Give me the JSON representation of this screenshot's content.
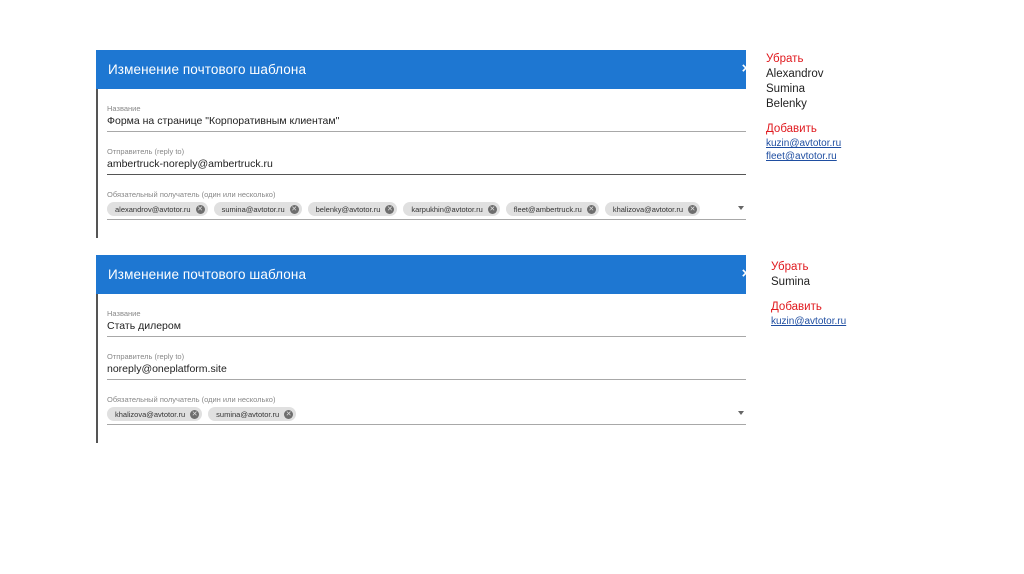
{
  "dialogs": [
    {
      "title": "Изменение почтового шаблона",
      "close_glyph": "×",
      "name_label": "Название",
      "name_value": "Форма на странице \"Корпоративным клиентам\"",
      "sender_label": "Отправитель (reply to)",
      "sender_value": "ambertruck-noreply@ambertruck.ru",
      "recipients_label": "Обязательный получатель (один или несколько)",
      "recipients": [
        "alexandrov@avtotor.ru",
        "sumina@avtotor.ru",
        "belenky@avtotor.ru",
        "karpukhin@avtotor.ru",
        "fleet@ambertruck.ru",
        "khalizova@avtotor.ru"
      ]
    },
    {
      "title": "Изменение почтового шаблона",
      "close_glyph": "×",
      "name_label": "Название",
      "name_value": "Стать дилером",
      "sender_label": "Отправитель (reply to)",
      "sender_value": "noreply@oneplatform.site",
      "recipients_label": "Обязательный получатель (один или несколько)",
      "recipients": [
        "khalizova@avtotor.ru",
        "sumina@avtotor.ru"
      ]
    }
  ],
  "notes": [
    {
      "remove_heading": "Убрать",
      "remove_items": [
        "Alexandrov",
        "Sumina",
        "Belenky"
      ],
      "add_heading": "Добавить",
      "add_links": [
        "kuzin@avtotor.ru",
        "fleet@avtotor.ru"
      ]
    },
    {
      "remove_heading": "Убрать",
      "remove_items": [
        "Sumina"
      ],
      "add_heading": "Добавить",
      "add_links": [
        "kuzin@avtotor.ru"
      ]
    }
  ],
  "chip_remove_glyph": "✕",
  "colors": {
    "header": "#1e77d2",
    "note_red": "#e0191e",
    "link": "#1f4ea1"
  }
}
